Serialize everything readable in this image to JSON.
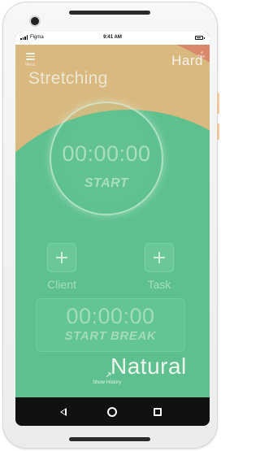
{
  "status_bar": {
    "carrier": "Figma",
    "time": "9:41 AM"
  },
  "header": {
    "menu_label": "Menu",
    "level": "Hard",
    "category": "Stretching"
  },
  "timer": {
    "time": "00:00:00",
    "start_label": "START"
  },
  "actions": {
    "client_label": "Client",
    "task_label": "Task"
  },
  "break_timer": {
    "time": "00:00:00",
    "label": "START BREAK"
  },
  "footer": {
    "mode": "Natural",
    "history_label": "Show History"
  },
  "icons": {
    "menu": "menu-icon",
    "add": "plus-icon",
    "back": "back-icon",
    "home": "home-icon",
    "recent": "recent-apps-icon"
  },
  "colors": {
    "background_outer": "#d98a6d",
    "band": "#d9b980",
    "green": "#5fc08f",
    "text_green": "#a7dfbd"
  }
}
